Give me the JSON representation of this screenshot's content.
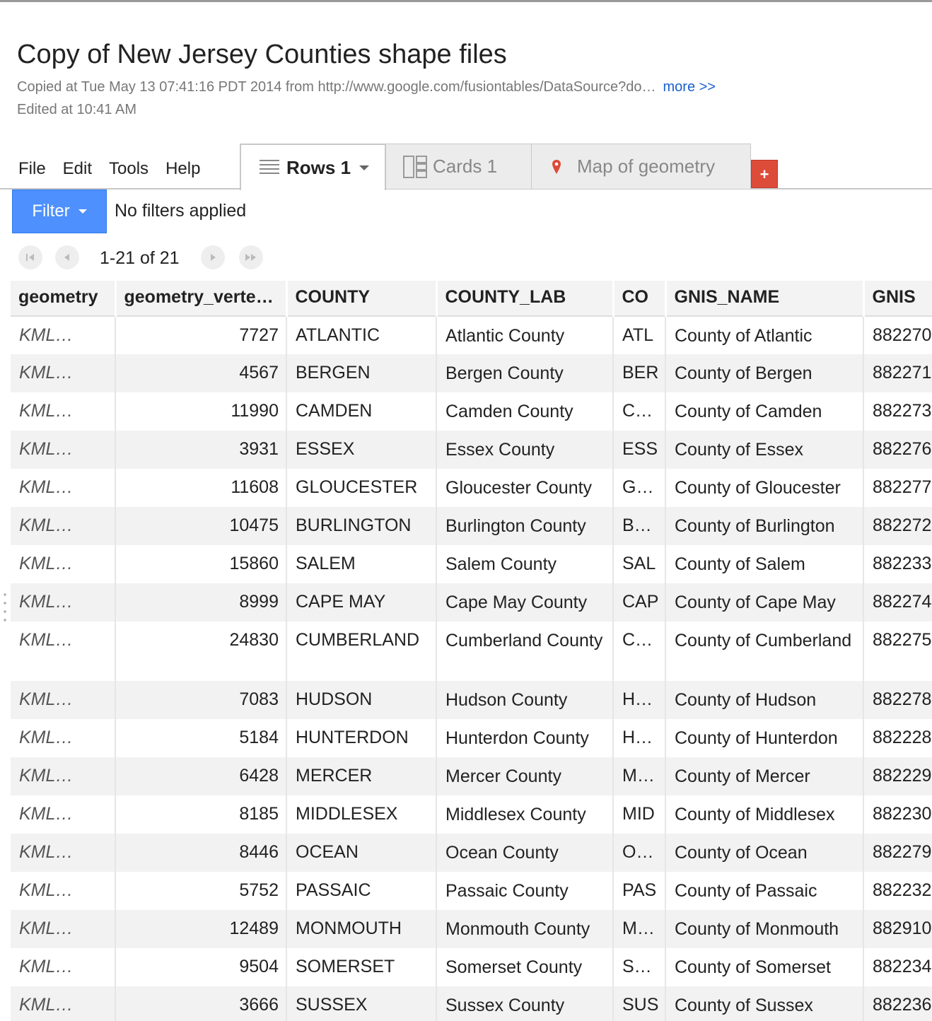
{
  "header": {
    "title": "Copy of New Jersey Counties shape files",
    "copied_text": "Copied at Tue May 13 07:41:16 PDT 2014 from http://www.google.com/fusiontables/DataSource?do…",
    "more_label": "more >>",
    "edited_text": "Edited at 10:41 AM"
  },
  "menu": [
    "File",
    "Edit",
    "Tools",
    "Help"
  ],
  "tabs": {
    "rows": "Rows 1",
    "cards": "Cards 1",
    "map": "Map of geometry",
    "add": "+"
  },
  "filter": {
    "button": "Filter",
    "status": "No filters applied"
  },
  "pager": {
    "count": "1-21 of 21"
  },
  "table": {
    "columns": [
      "geometry",
      "geometry_verte…",
      "COUNTY",
      "COUNTY_LAB",
      "CO",
      "GNIS_NAME",
      "GNIS"
    ],
    "rows": [
      [
        "KML…",
        "7727",
        "ATLANTIC",
        "Atlantic County",
        "ATL",
        "County of Atlantic",
        "882270"
      ],
      [
        "KML…",
        "4567",
        "BERGEN",
        "Bergen County",
        "BER",
        "County of Bergen",
        "882271"
      ],
      [
        "KML…",
        "11990",
        "CAMDEN",
        "Camden County",
        "C…",
        "County of Camden",
        "882273"
      ],
      [
        "KML…",
        "3931",
        "ESSEX",
        "Essex County",
        "ESS",
        "County of Essex",
        "882276"
      ],
      [
        "KML…",
        "11608",
        "GLOUCESTER",
        "Gloucester County",
        "G…",
        "County of Gloucester",
        "882277"
      ],
      [
        "KML…",
        "10475",
        "BURLINGTON",
        "Burlington County",
        "B…",
        "County of Burlington",
        "882272"
      ],
      [
        "KML…",
        "15860",
        "SALEM",
        "Salem County",
        "SAL",
        "County of Salem",
        "882233"
      ],
      [
        "KML…",
        "8999",
        "CAPE MAY",
        "Cape May County",
        "CAP",
        "County of Cape May",
        "882274"
      ],
      [
        "KML…",
        "24830",
        "CUMBERLAND",
        "Cumberland County",
        "C…",
        "County of Cumberland",
        "882275"
      ],
      [
        "KML…",
        "7083",
        "HUDSON",
        "Hudson County",
        "H…",
        "County of Hudson",
        "882278"
      ],
      [
        "KML…",
        "5184",
        "HUNTERDON",
        "Hunterdon County",
        "H…",
        "County of Hunterdon",
        "882228"
      ],
      [
        "KML…",
        "6428",
        "MERCER",
        "Mercer County",
        "M…",
        "County of Mercer",
        "882229"
      ],
      [
        "KML…",
        "8185",
        "MIDDLESEX",
        "Middlesex County",
        "MID",
        "County of Middlesex",
        "882230"
      ],
      [
        "KML…",
        "8446",
        "OCEAN",
        "Ocean County",
        "O…",
        "County of Ocean",
        "882279"
      ],
      [
        "KML…",
        "5752",
        "PASSAIC",
        "Passaic County",
        "PAS",
        "County of Passaic",
        "882232"
      ],
      [
        "KML…",
        "12489",
        "MONMOUTH",
        "Monmouth County",
        "M…",
        "County of Monmouth",
        "882910"
      ],
      [
        "KML…",
        "9504",
        "SOMERSET",
        "Somerset County",
        "S…",
        "County of Somerset",
        "882234"
      ],
      [
        "KML…",
        "3666",
        "SUSSEX",
        "Sussex County",
        "SUS",
        "County of Sussex",
        "882236"
      ]
    ]
  },
  "colors": {
    "filter_button": "#4d90fe",
    "add_tab": "#dd4b39",
    "link": "#1a5fd0",
    "map_pin": "#dd4b39"
  },
  "icons": {
    "rows_tab": "rows-list-icon",
    "cards_tab": "cards-icon",
    "map_tab": "map-pin-icon",
    "pager": [
      "first-page-icon",
      "prev-page-icon",
      "next-page-icon",
      "last-page-icon"
    ]
  }
}
